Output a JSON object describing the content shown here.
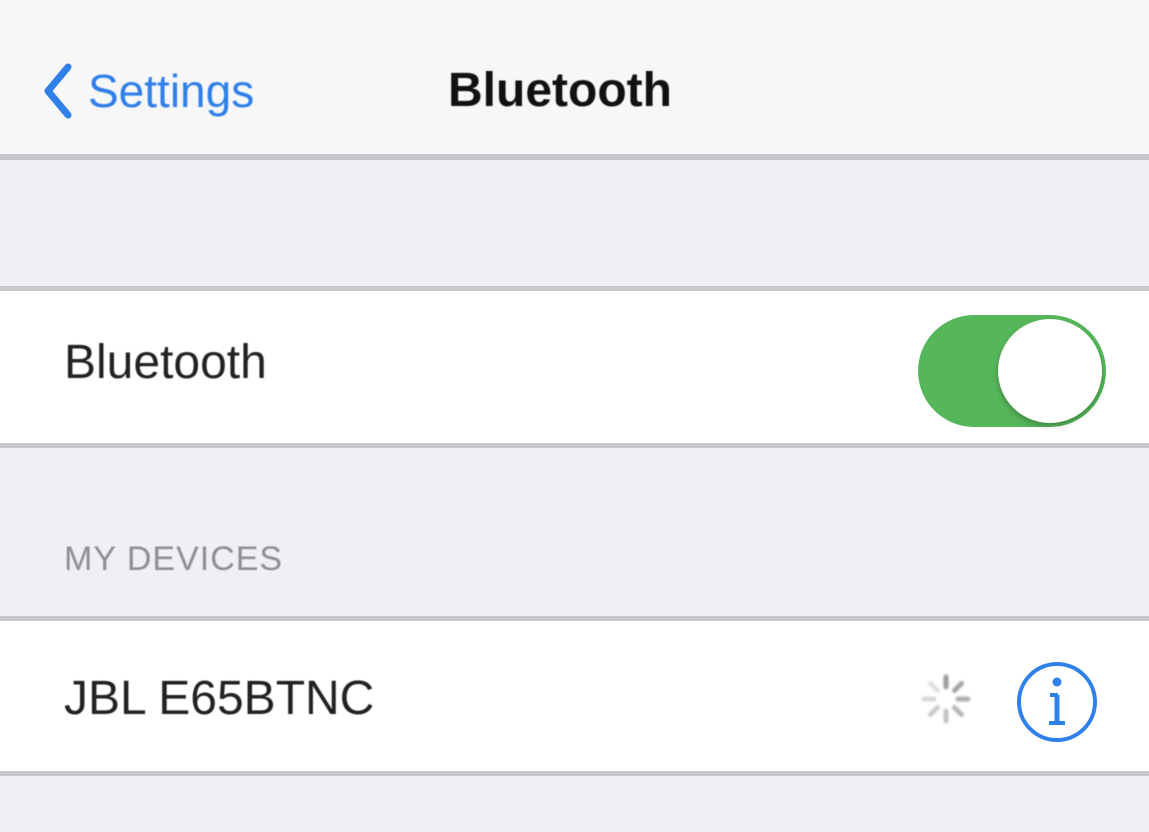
{
  "navbar": {
    "back_label": "Settings",
    "title": "Bluetooth"
  },
  "bluetooth_row": {
    "label": "Bluetooth",
    "toggle_on": true,
    "toggle_color": "#56b65a"
  },
  "my_devices": {
    "header": "MY DEVICES",
    "items": [
      {
        "name": "JBL E65BTNC",
        "status_icon": "spinner-icon",
        "accessory_icon": "info-icon"
      }
    ]
  },
  "colors": {
    "accent": "#2f80e8",
    "background": "#efeff4",
    "separator": "#c8c7cc"
  }
}
